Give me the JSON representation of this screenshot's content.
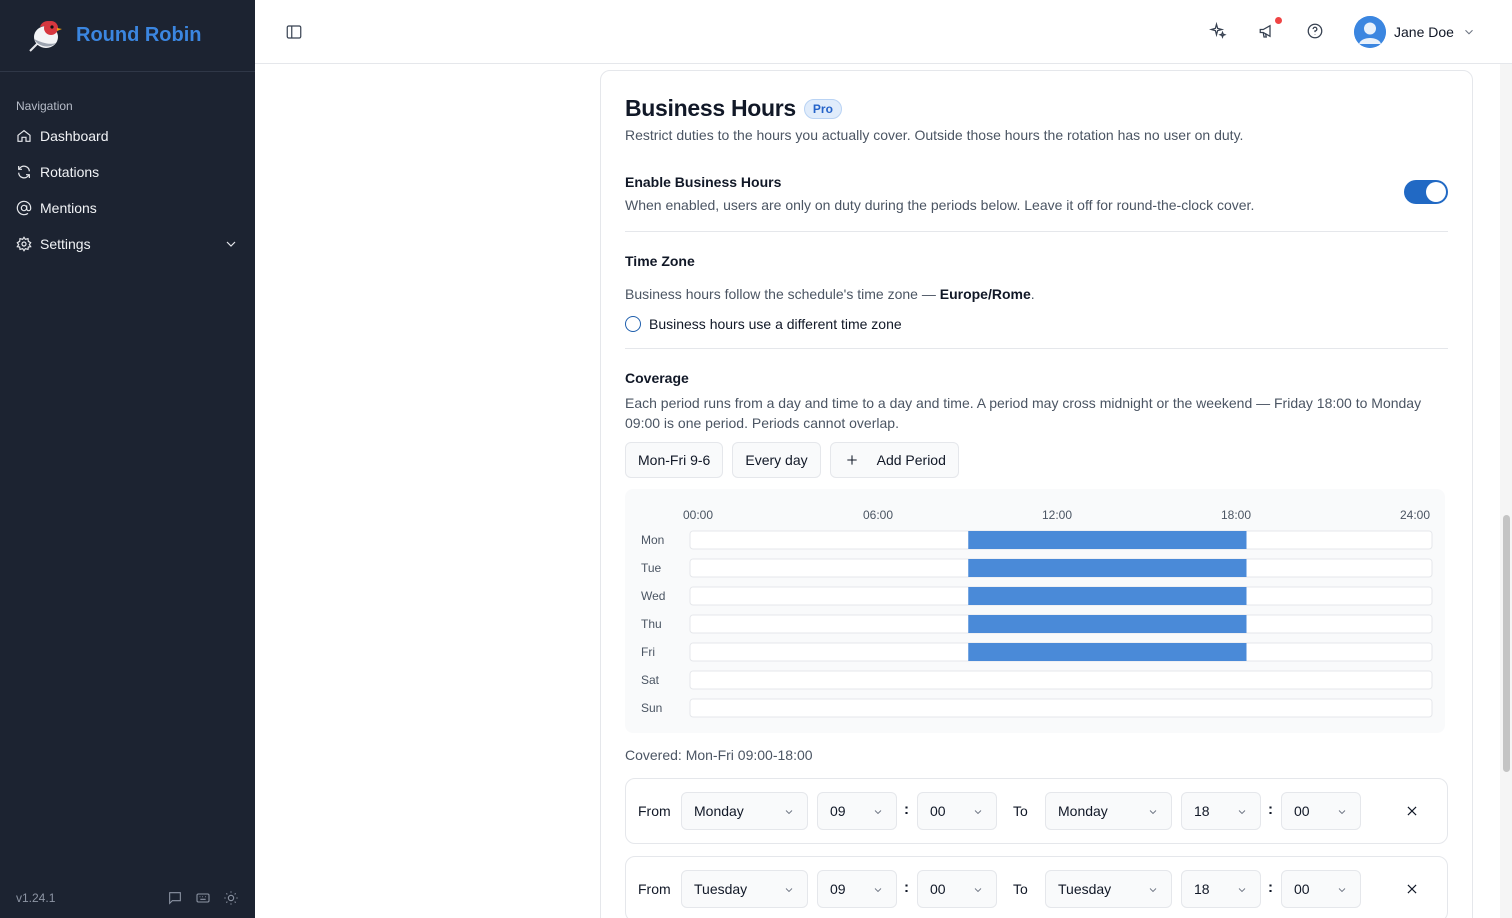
{
  "app": {
    "name": "Round Robin",
    "version": "v1.24.1"
  },
  "sidebar": {
    "heading": "Navigation",
    "items": [
      {
        "label": "Dashboard",
        "icon": "home-icon"
      },
      {
        "label": "Rotations",
        "icon": "refresh-icon"
      },
      {
        "label": "Mentions",
        "icon": "at-sign-icon"
      },
      {
        "label": "Settings",
        "icon": "gear-icon"
      }
    ],
    "footer_icons": [
      "message-icon",
      "keyboard-icon",
      "sun-icon"
    ]
  },
  "topbar": {
    "icons": [
      "sparkles-icon",
      "megaphone-icon",
      "help-circle-icon"
    ],
    "user_name": "Jane Doe"
  },
  "card": {
    "title": "Business Hours",
    "badge": "Pro",
    "subtitle": "Restrict duties to the hours you actually cover. Outside those hours the rotation has no user on duty.",
    "enable": {
      "label": "Enable Business Hours",
      "description": "When enabled, users are only on duty during the periods below. Leave it off for round-the-clock cover.",
      "enabled": true
    },
    "timezone": {
      "label": "Time Zone",
      "text_prefix": "Business hours follow the schedule's time zone — ",
      "zone": "Europe/Rome",
      "text_suffix": ".",
      "radio_label": "Business hours use a different time zone"
    },
    "coverage": {
      "label": "Coverage",
      "description_line1": "Each period runs from a day and time to a day and time. A period may cross midnight or the weekend — Friday 18:00 to Monday",
      "description_line2": "09:00 is one period. Periods cannot overlap.",
      "presets": [
        "Mon-Fri 9-6",
        "Every day"
      ],
      "add_label": "Add Period",
      "covered_text": "Covered: Mon-Fri 09:00-18:00"
    },
    "periods": [
      {
        "from_label": "From",
        "from_day": "Monday",
        "from_hour": "09",
        "from_min": "00",
        "to_label": "To",
        "to_day": "Monday",
        "to_hour": "18",
        "to_min": "00"
      },
      {
        "from_label": "From",
        "from_day": "Tuesday",
        "from_hour": "09",
        "from_min": "00",
        "to_label": "To",
        "to_day": "Tuesday",
        "to_hour": "18",
        "to_min": "00"
      }
    ]
  },
  "chart_data": {
    "type": "bar",
    "orientation": "horizontal-timeline",
    "x_ticks": [
      "00:00",
      "06:00",
      "12:00",
      "18:00",
      "24:00"
    ],
    "xlim": [
      0,
      24
    ],
    "categories": [
      "Mon",
      "Tue",
      "Wed",
      "Thu",
      "Fri",
      "Sat",
      "Sun"
    ],
    "ranges": [
      [
        9,
        18
      ],
      [
        9,
        18
      ],
      [
        9,
        18
      ],
      [
        9,
        18
      ],
      [
        9,
        18
      ],
      null,
      null
    ],
    "bar_color": "#4a8ad8"
  }
}
